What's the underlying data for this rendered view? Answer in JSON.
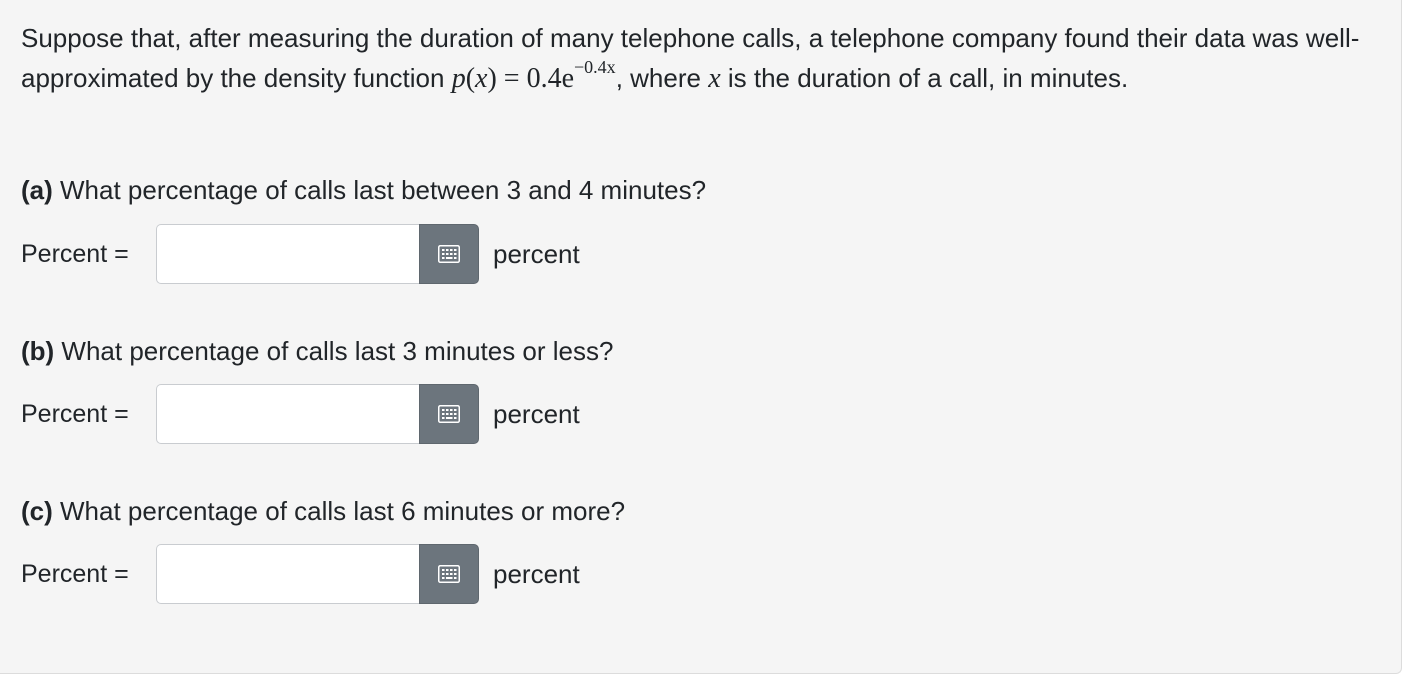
{
  "intro": {
    "text_before": "Suppose that, after measuring the duration of many telephone calls, a telephone company found their data was well-approximated by the density function ",
    "formula_lhs": "p",
    "formula_var": "x",
    "formula_rhs": "0.4e",
    "formula_exp": "−0.4x",
    "text_middle": ", where ",
    "var_inline": "x",
    "text_after": " is the duration of a call, in minutes."
  },
  "parts": [
    {
      "tag": "(a)",
      "question": " What percentage of calls last between 3 and 4 minutes?",
      "label": "Percent =",
      "value": "",
      "unit": "percent"
    },
    {
      "tag": "(b)",
      "question": " What percentage of calls last 3 minutes or less?",
      "label": "Percent =",
      "value": "",
      "unit": "percent"
    },
    {
      "tag": "(c)",
      "question": " What percentage of calls last 6 minutes or more?",
      "label": "Percent =",
      "value": "",
      "unit": "percent"
    }
  ],
  "icons": {
    "keypad": "keypad-icon"
  },
  "colors": {
    "keypad_button": "#6c757d",
    "card_background": "#f5f5f5"
  }
}
